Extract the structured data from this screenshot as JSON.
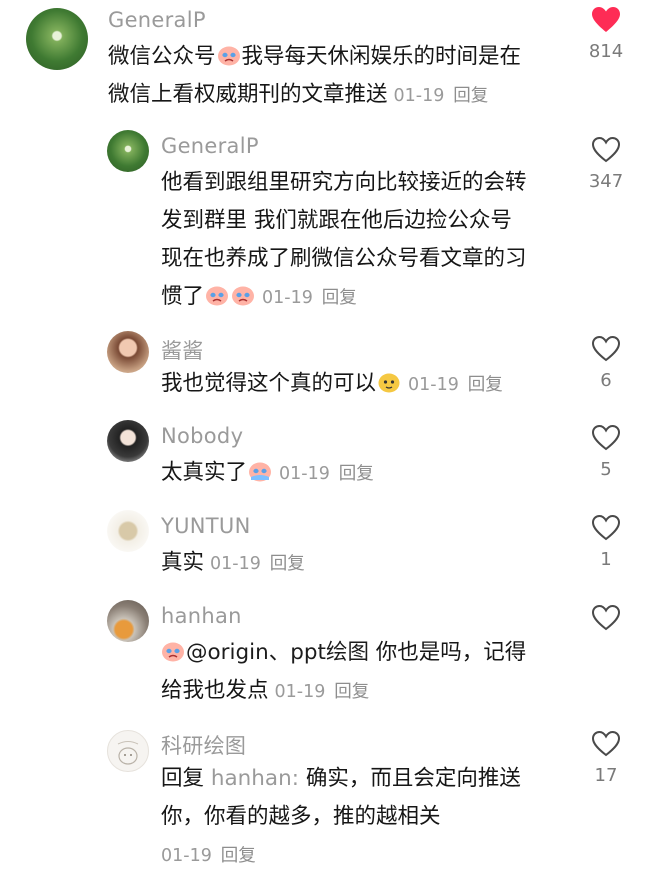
{
  "comments": [
    {
      "name": "GeneralP",
      "lines": [
        "微信公众号",
        "我导每天休闲娱乐的时间是在",
        "微信上看权威期刊的文章推送"
      ],
      "date": "01-19",
      "reply": "回复",
      "likes": "814",
      "liked": true
    },
    {
      "name": "GeneralP",
      "lines": [
        "他看到跟组里研究方向比较接近的会转",
        "发到群里 我们就跟在他后边捡公众号",
        "现在也养成了刷微信公众号看文章的习",
        "惯了"
      ],
      "date": "01-19",
      "reply": "回复",
      "likes": "347",
      "liked": false
    },
    {
      "name": "酱酱",
      "lines": [
        "我也觉得这个真的可以"
      ],
      "date": "01-19",
      "reply": "回复",
      "likes": "6",
      "liked": false
    },
    {
      "name": "Nobody",
      "lines": [
        "太真实了"
      ],
      "date": "01-19",
      "reply": "回复",
      "likes": "5",
      "liked": false
    },
    {
      "name": "YUNTUN",
      "lines": [
        "真实"
      ],
      "date": "01-19",
      "reply": "回复",
      "likes": "1",
      "liked": false
    },
    {
      "name": "hanhan",
      "lines": [
        "@origin、ppt绘图",
        "你也是吗，记得",
        "给我也发点"
      ],
      "date": "01-19",
      "reply": "回复",
      "likes": "",
      "liked": false
    },
    {
      "name": "科研绘图",
      "lines": [
        "回复",
        "hanhan:",
        "确实，而且会定向推送",
        "你，你看的越多，推的越相关"
      ],
      "date": "01-19",
      "reply": "回复",
      "likes": "17",
      "liked": false
    }
  ],
  "colors": {
    "liked": "#fe2c55",
    "meta": "#9a9a9a",
    "text": "#161616"
  },
  "icons": {
    "like": "heart-icon",
    "emoji": "crying-face-emoji"
  }
}
